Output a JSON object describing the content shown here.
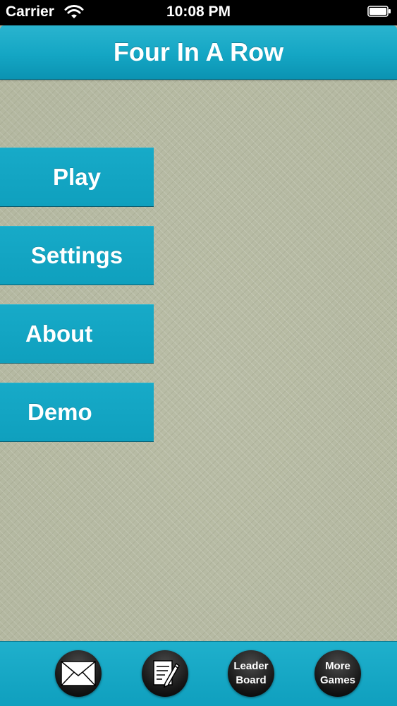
{
  "status_bar": {
    "carrier": "Carrier",
    "time": "10:08 PM"
  },
  "header": {
    "title": "Four In A Row"
  },
  "menu": {
    "items": [
      {
        "label": "Play"
      },
      {
        "label": "Settings"
      },
      {
        "label": "About"
      },
      {
        "label": "Demo"
      }
    ]
  },
  "tab_bar": {
    "leaderboard": {
      "line1": "Leader",
      "line2": "Board"
    },
    "more_games": {
      "line1": "More",
      "line2": "Games"
    }
  },
  "colors": {
    "accent": "#14a6c4",
    "background": "#b9bda6"
  }
}
